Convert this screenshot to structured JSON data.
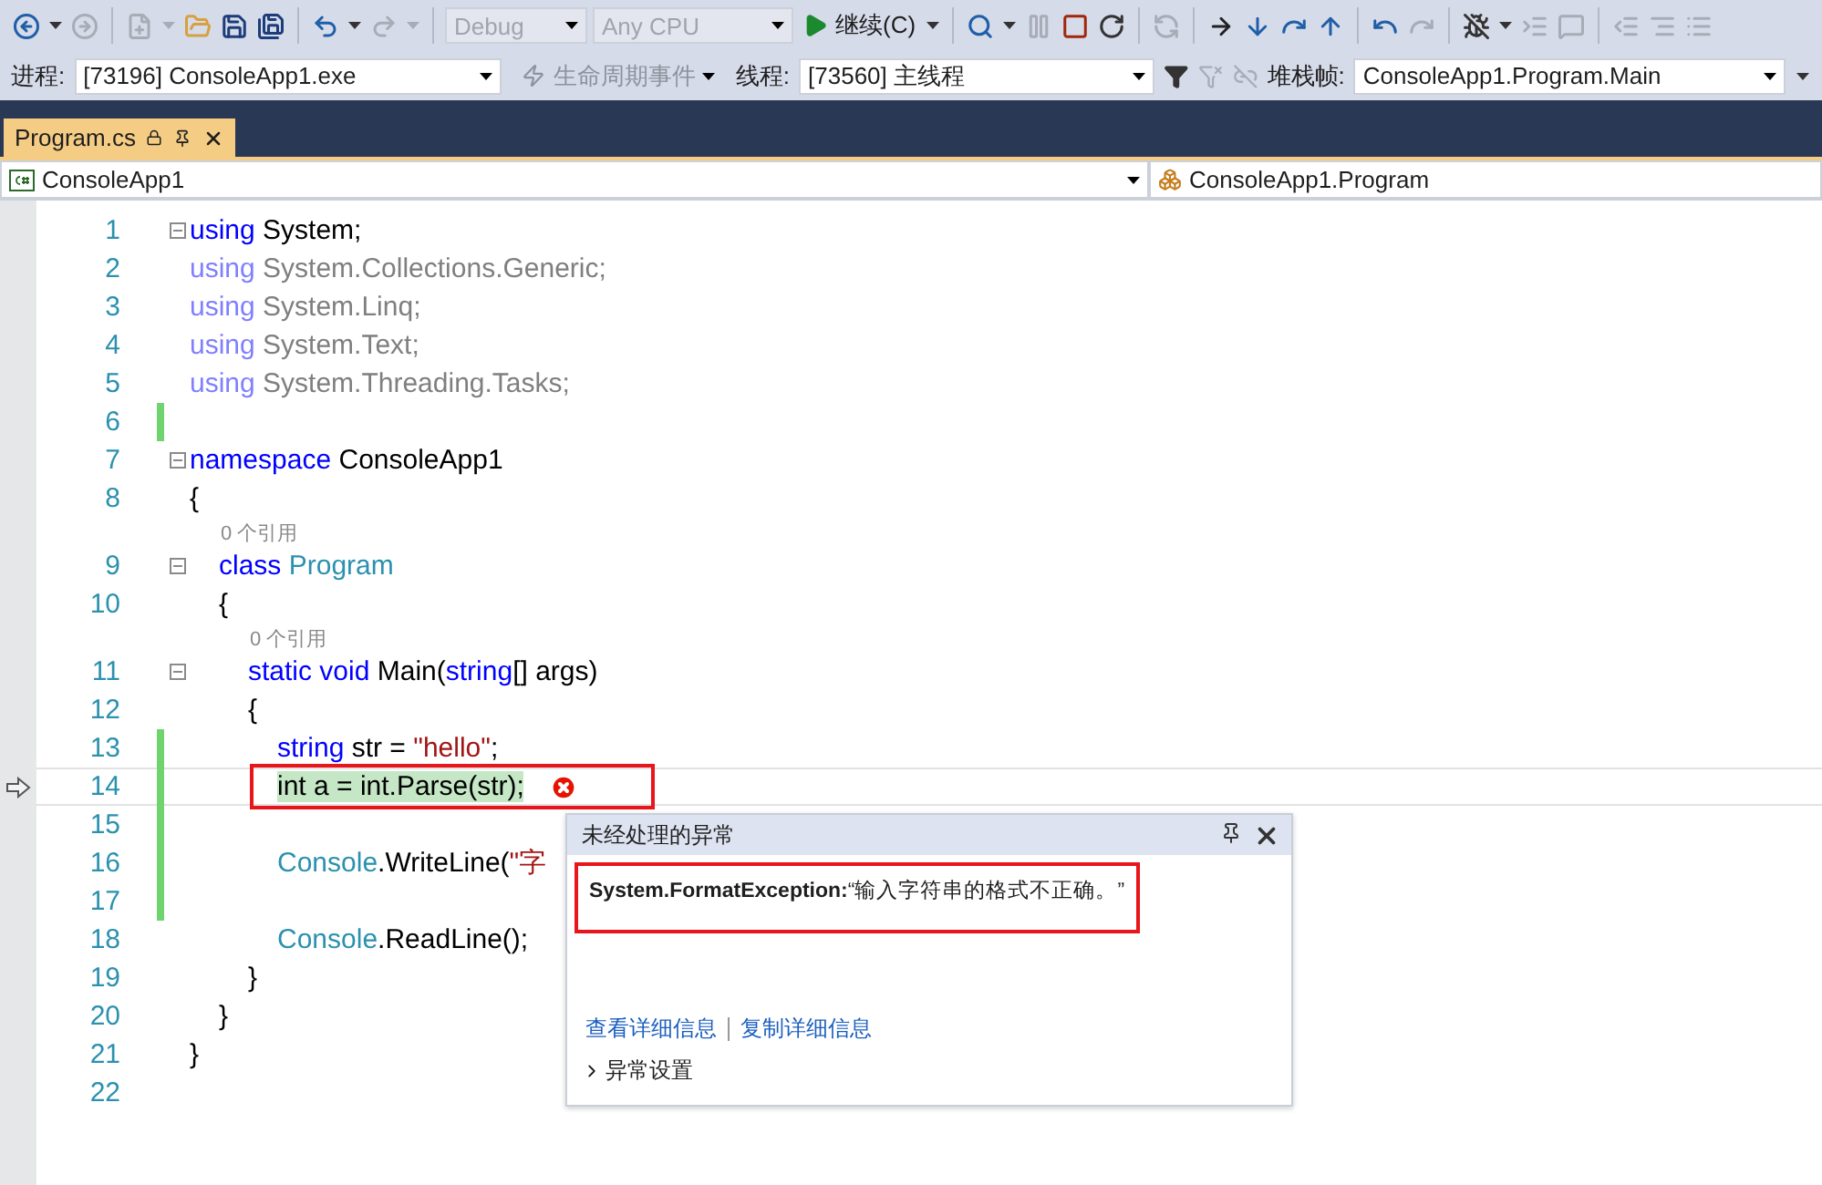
{
  "toolbar": {
    "items": [
      {
        "kind": "back",
        "disabled": false
      },
      {
        "kind": "caret",
        "disabled": false
      },
      {
        "kind": "forward",
        "disabled": true
      },
      {
        "kind": "sep"
      },
      {
        "kind": "new-item",
        "disabled": true
      },
      {
        "kind": "caret",
        "disabled": true
      },
      {
        "kind": "open",
        "disabled": false
      },
      {
        "kind": "save",
        "disabled": false
      },
      {
        "kind": "save-all",
        "disabled": false
      },
      {
        "kind": "sep"
      },
      {
        "kind": "undo",
        "disabled": false
      },
      {
        "kind": "caret",
        "disabled": false
      },
      {
        "kind": "redo",
        "disabled": true
      },
      {
        "kind": "caret",
        "disabled": true
      },
      {
        "kind": "sep"
      },
      {
        "kind": "combo",
        "value": "Debug",
        "disabled": true
      },
      {
        "kind": "combo",
        "value": "Any CPU",
        "disabled": true
      },
      {
        "kind": "run",
        "label": "继续(C)",
        "disabled": false
      },
      {
        "kind": "caret",
        "disabled": false
      },
      {
        "kind": "sep"
      },
      {
        "kind": "find",
        "disabled": false
      },
      {
        "kind": "caret",
        "disabled": false
      },
      {
        "kind": "pause",
        "disabled": true
      },
      {
        "kind": "stop",
        "disabled": false
      },
      {
        "kind": "restart",
        "disabled": false
      },
      {
        "kind": "sep"
      },
      {
        "kind": "hot-reload",
        "disabled": true
      },
      {
        "kind": "sep"
      },
      {
        "kind": "step-next",
        "disabled": false
      },
      {
        "kind": "step-into",
        "disabled": false
      },
      {
        "kind": "step-over",
        "disabled": false
      },
      {
        "kind": "step-out",
        "disabled": false
      },
      {
        "kind": "sep"
      },
      {
        "kind": "step-back",
        "disabled": false
      },
      {
        "kind": "step-forward",
        "disabled": true
      },
      {
        "kind": "sep"
      },
      {
        "kind": "break-all",
        "disabled": false
      },
      {
        "kind": "caret",
        "disabled": false
      },
      {
        "kind": "indent",
        "disabled": true
      },
      {
        "kind": "comment",
        "disabled": true
      },
      {
        "kind": "sep"
      },
      {
        "kind": "outdent",
        "disabled": true
      },
      {
        "kind": "indent-more",
        "disabled": true
      },
      {
        "kind": "list",
        "disabled": true
      }
    ]
  },
  "debug_location": {
    "process_label": "进程:",
    "process": "[73196] ConsoleApp1.exe",
    "lifecycle": {
      "label": "生命周期事件",
      "disabled": true
    },
    "thread_label": "线程:",
    "thread": "[73560] 主线程",
    "stack_label": "堆栈帧:",
    "stack_frame": "ConsoleApp1.Program.Main"
  },
  "tabs": [
    {
      "label": "Program.cs",
      "selected": true
    }
  ],
  "nav_bar": {
    "project": "ConsoleApp1",
    "type": "ConsoleApp1.Program"
  },
  "editor": {
    "lines": [
      {
        "kind": "code",
        "number": "1",
        "foldable": true,
        "changed": false,
        "current": false,
        "boxed": false,
        "error": false,
        "tokens": [
          {
            "kind": "keyword",
            "text": "using"
          },
          {
            "kind": "text",
            "text": " System;"
          }
        ]
      },
      {
        "kind": "code",
        "number": "2",
        "foldable": false,
        "changed": false,
        "current": false,
        "boxed": false,
        "error": false,
        "tokens": [
          {
            "kind": "faded-keyword",
            "text": "using"
          },
          {
            "kind": "faded",
            "text": " System.Collections.Generic;"
          }
        ]
      },
      {
        "kind": "code",
        "number": "3",
        "foldable": false,
        "changed": false,
        "current": false,
        "boxed": false,
        "error": false,
        "tokens": [
          {
            "kind": "faded-keyword",
            "text": "using"
          },
          {
            "kind": "faded",
            "text": " System.Linq;"
          }
        ]
      },
      {
        "kind": "code",
        "number": "4",
        "foldable": false,
        "changed": false,
        "current": false,
        "boxed": false,
        "error": false,
        "tokens": [
          {
            "kind": "faded-keyword",
            "text": "using"
          },
          {
            "kind": "faded",
            "text": " System.Text;"
          }
        ]
      },
      {
        "kind": "code",
        "number": "5",
        "foldable": false,
        "changed": false,
        "current": false,
        "boxed": false,
        "error": false,
        "tokens": [
          {
            "kind": "faded-keyword",
            "text": "using"
          },
          {
            "kind": "faded",
            "text": " System.Threading.Tasks;"
          }
        ]
      },
      {
        "kind": "code",
        "number": "6",
        "foldable": false,
        "changed": true,
        "current": false,
        "boxed": false,
        "error": false
      },
      {
        "kind": "code",
        "number": "7",
        "foldable": true,
        "changed": false,
        "current": false,
        "boxed": false,
        "error": false,
        "tokens": [
          {
            "kind": "keyword",
            "text": "namespace"
          },
          {
            "kind": "text",
            "text": " ConsoleApp1"
          }
        ]
      },
      {
        "kind": "code",
        "number": "8",
        "foldable": false,
        "changed": false,
        "current": false,
        "boxed": false,
        "error": false,
        "tokens": [
          {
            "kind": "text",
            "text": "{"
          }
        ],
        "children": [
          {
            "kind": "lens",
            "text": "0 个引用"
          },
          {
            "kind": "code",
            "number": "9",
            "foldable": true,
            "changed": false,
            "current": false,
            "boxed": false,
            "error": false,
            "tokens": [
              {
                "kind": "keyword",
                "text": "class"
              },
              {
                "kind": "type",
                "text": " Program"
              }
            ]
          },
          {
            "kind": "code",
            "number": "10",
            "foldable": false,
            "changed": false,
            "current": false,
            "boxed": false,
            "error": false,
            "tokens": [
              {
                "kind": "text",
                "text": "{"
              }
            ],
            "children": [
              {
                "kind": "lens",
                "text": "0 个引用"
              },
              {
                "kind": "code",
                "number": "11",
                "foldable": true,
                "changed": false,
                "current": false,
                "boxed": false,
                "error": false,
                "tokens": [
                  {
                    "kind": "keyword",
                    "text": "static void"
                  },
                  {
                    "kind": "text",
                    "text": " Main("
                  },
                  {
                    "kind": "keyword",
                    "text": "string"
                  },
                  {
                    "kind": "text",
                    "text": "[] args)"
                  }
                ]
              },
              {
                "kind": "code",
                "number": "12",
                "foldable": false,
                "changed": false,
                "current": false,
                "boxed": false,
                "error": false,
                "tokens": [
                  {
                    "kind": "text",
                    "text": "{"
                  }
                ],
                "children": [
                  {
                    "kind": "code",
                    "number": "13",
                    "foldable": false,
                    "changed": true,
                    "current": false,
                    "boxed": false,
                    "error": false,
                    "tokens": [
                      {
                        "kind": "keyword",
                        "text": "string"
                      },
                      {
                        "kind": "text",
                        "text": " str = "
                      },
                      {
                        "kind": "string",
                        "text": "\"hello\""
                      },
                      {
                        "kind": "text",
                        "text": ";"
                      }
                    ]
                  },
                  {
                    "kind": "code",
                    "number": "14",
                    "foldable": false,
                    "changed": true,
                    "current": true,
                    "boxed": true,
                    "error": true,
                    "tokens": [
                      {
                        "kind": "highlight",
                        "text": "int a = int.Parse(str);"
                      }
                    ]
                  },
                  {
                    "kind": "code",
                    "number": "15",
                    "foldable": false,
                    "changed": true,
                    "current": false,
                    "boxed": false,
                    "error": false
                  },
                  {
                    "kind": "code",
                    "number": "16",
                    "foldable": false,
                    "changed": true,
                    "current": false,
                    "boxed": false,
                    "error": false,
                    "tokens": [
                      {
                        "kind": "type",
                        "text": "Console"
                      },
                      {
                        "kind": "text",
                        "text": ".WriteLine("
                      },
                      {
                        "kind": "string",
                        "text": "\"字"
                      }
                    ]
                  },
                  {
                    "kind": "code",
                    "number": "17",
                    "foldable": false,
                    "changed": true,
                    "current": false,
                    "boxed": false,
                    "error": false
                  },
                  {
                    "kind": "code",
                    "number": "18",
                    "foldable": false,
                    "changed": false,
                    "current": false,
                    "boxed": false,
                    "error": false,
                    "tokens": [
                      {
                        "kind": "type",
                        "text": "Console"
                      },
                      {
                        "kind": "text",
                        "text": ".ReadLine();"
                      }
                    ]
                  }
                ]
              },
              {
                "kind": "code",
                "number": "19",
                "foldable": false,
                "changed": false,
                "current": false,
                "boxed": false,
                "error": false,
                "tokens": [
                  {
                    "kind": "text",
                    "text": "}"
                  }
                ]
              }
            ]
          },
          {
            "kind": "code",
            "number": "20",
            "foldable": false,
            "changed": false,
            "current": false,
            "boxed": false,
            "error": false,
            "tokens": [
              {
                "kind": "text",
                "text": "}"
              }
            ]
          }
        ]
      },
      {
        "kind": "code",
        "number": "21",
        "foldable": false,
        "changed": false,
        "current": false,
        "boxed": false,
        "error": false,
        "tokens": [
          {
            "kind": "text",
            "text": "}"
          }
        ]
      },
      {
        "kind": "code",
        "number": "22",
        "foldable": false,
        "changed": false,
        "current": false
      }
    ]
  },
  "exception_popup": {
    "title": "未经处理的异常",
    "message": "**System.FormatException:**“输入字符串的格式不正确。”",
    "boxed": true,
    "links": [
      "查看详细信息",
      "复制详细信息"
    ],
    "settings": {
      "label": "异常设置",
      "expanded": false
    }
  }
}
